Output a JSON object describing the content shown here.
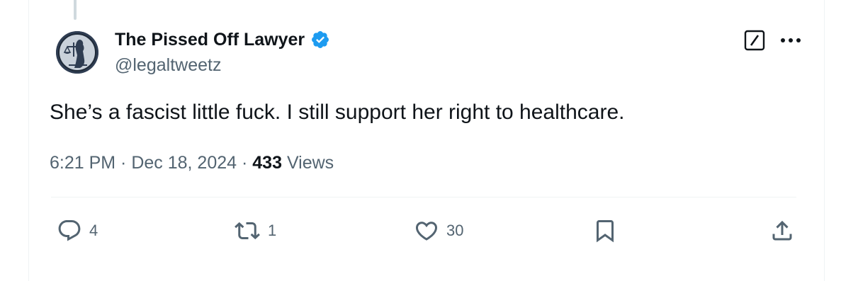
{
  "author": {
    "display_name": "The Pissed Off Lawyer",
    "handle": "@legaltweetz",
    "verified": true,
    "avatar_icon": "lady-justice-avatar"
  },
  "tweet": {
    "text": "She’s a fascist little fuck. I still support her right to healthcare.",
    "time": "6:21 PM",
    "date": "Dec 18, 2024",
    "views_count": "433",
    "views_label": "Views",
    "separator": " · "
  },
  "actions": {
    "replies": "4",
    "reposts": "1",
    "likes": "30"
  },
  "colors": {
    "verified": "#1d9bf0",
    "secondary_text": "#536471",
    "primary_text": "#0f1419"
  }
}
